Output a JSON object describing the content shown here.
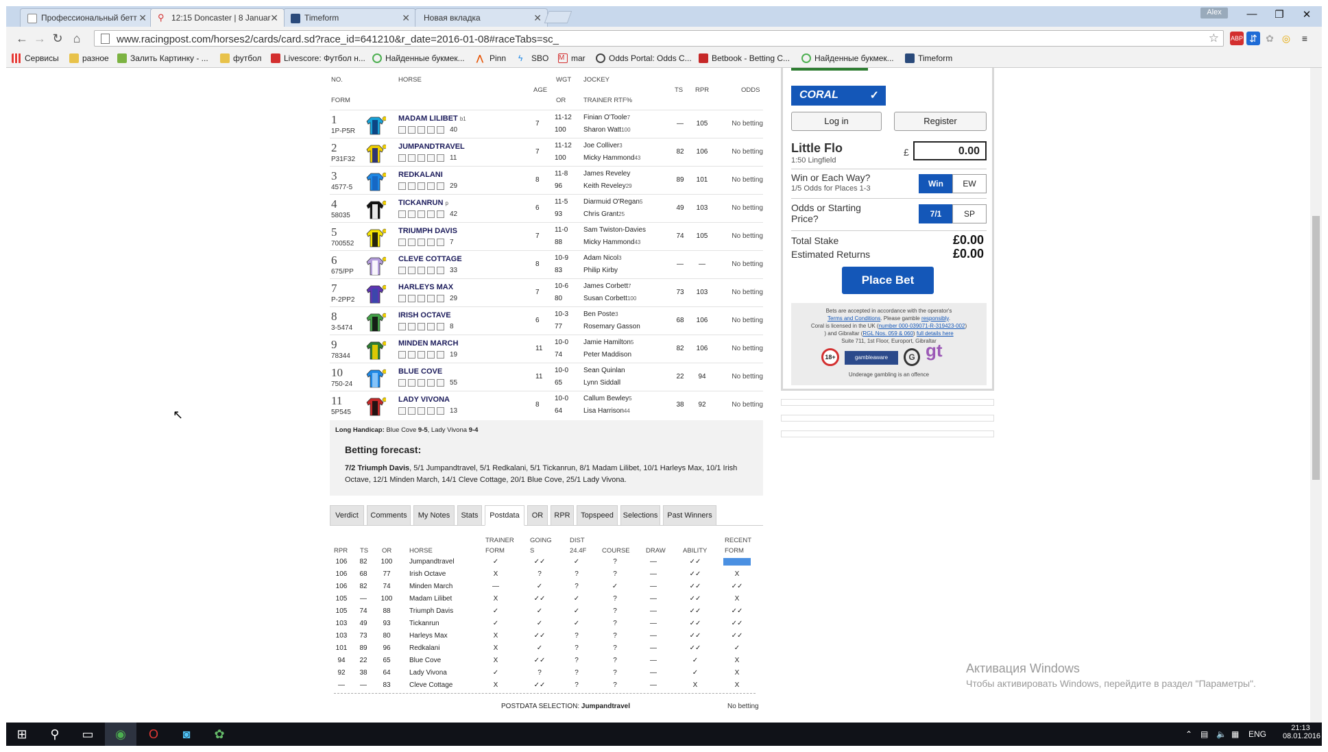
{
  "tabs": [
    {
      "title": "Профессиональный бетт",
      "active": false
    },
    {
      "title": "12:15 Doncaster | 8 Januar",
      "active": true
    },
    {
      "title": "Timeform",
      "active": false
    },
    {
      "title": "Новая вкладка",
      "active": false
    }
  ],
  "window": {
    "user": "Alex",
    "minimize": "—",
    "restore": "❐",
    "close": "✕"
  },
  "toolbar": {
    "url": "www.racingpost.com/horses2/cards/card.sd?race_id=641210&r_date=2016-01-08#raceTabs=sc_"
  },
  "bookmarks": [
    "Сервисы",
    "разное",
    "Залить Картинку - ...",
    "футбол",
    "Livescore: Футбол н...",
    "Найденные букмек...",
    "Pinn",
    "SBO",
    "mar",
    "Odds Portal: Odds C...",
    "Betbook - Betting C...",
    "Найденные букмек...",
    "Timeform"
  ],
  "card_headers": {
    "no": "NO.",
    "horse": "HORSE",
    "form": "FORM",
    "age": "AGE",
    "wgt": "WGT",
    "or": "OR",
    "jockey": "JOCKEY",
    "trainer": "TRAINER RTF%",
    "ts": "TS",
    "rpr": "RPR",
    "odds": "ODDS"
  },
  "runners": [
    {
      "no": "1",
      "form": "1P-P5R",
      "name": "MADAM LILIBET",
      "gear": "b1",
      "days": "40",
      "age": "7",
      "wgt": "11-12",
      "or": "100",
      "jockey": "Finian O'Toole",
      "jclaim": "7",
      "trainer": "Sharon Watt",
      "tpct": "100",
      "ts": "—",
      "rpr": "105",
      "odds": "No betting",
      "colors": [
        "#19a3d8",
        "#0b3b7a"
      ]
    },
    {
      "no": "2",
      "form": "P31F32",
      "name": "JUMPANDTRAVEL",
      "gear": "",
      "days": "11",
      "age": "7",
      "wgt": "11-12",
      "or": "100",
      "jockey": "Joe Colliver",
      "jclaim": "3",
      "trainer": "Micky Hammond",
      "tpct": "43",
      "ts": "82",
      "rpr": "106",
      "odds": "No betting",
      "colors": [
        "#f0d000",
        "#1a237e"
      ]
    },
    {
      "no": "3",
      "form": "4577-5",
      "name": "REDKALANI",
      "gear": "",
      "days": "29",
      "age": "8",
      "wgt": "11-8",
      "or": "96",
      "jockey": "James Reveley",
      "jclaim": "",
      "trainer": "Keith Reveley",
      "tpct": "29",
      "ts": "89",
      "rpr": "101",
      "odds": "No betting",
      "colors": [
        "#1e88e5",
        "#1565c0"
      ]
    },
    {
      "no": "4",
      "form": "58035",
      "name": "TICKANRUN",
      "gear": "p",
      "days": "42",
      "age": "6",
      "wgt": "11-5",
      "or": "93",
      "jockey": "Diarmuid O'Regan",
      "jclaim": "5",
      "trainer": "Chris Grant",
      "tpct": "25",
      "ts": "49",
      "rpr": "103",
      "odds": "No betting",
      "colors": [
        "#111111",
        "#ffffff"
      ]
    },
    {
      "no": "5",
      "form": "700552",
      "name": "TRIUMPH DAVIS",
      "gear": "",
      "days": "7",
      "age": "7",
      "wgt": "11-0",
      "or": "88",
      "jockey": "Sam Twiston-Davies",
      "jclaim": "",
      "trainer": "Micky Hammond",
      "tpct": "43",
      "ts": "74",
      "rpr": "105",
      "odds": "No betting",
      "colors": [
        "#f5e400",
        "#111111"
      ]
    },
    {
      "no": "6",
      "form": "675/PP",
      "name": "CLEVE COTTAGE",
      "gear": "",
      "days": "33",
      "age": "8",
      "wgt": "10-9",
      "or": "83",
      "jockey": "Adam Nicol",
      "jclaim": "3",
      "trainer": "Philip Kirby",
      "tpct": "",
      "ts": "—",
      "rpr": "—",
      "odds": "No betting",
      "colors": [
        "#b39ddb",
        "#ffffff"
      ]
    },
    {
      "no": "7",
      "form": "P-2PP2",
      "name": "HARLEYS MAX",
      "gear": "",
      "days": "29",
      "age": "7",
      "wgt": "10-6",
      "or": "80",
      "jockey": "James Corbett",
      "jclaim": "7",
      "trainer": "Susan Corbett",
      "tpct": "100",
      "ts": "73",
      "rpr": "103",
      "odds": "No betting",
      "colors": [
        "#5e35b1",
        "#3949ab"
      ]
    },
    {
      "no": "8",
      "form": "3-5474",
      "name": "IRISH OCTAVE",
      "gear": "",
      "days": "8",
      "age": "6",
      "wgt": "10-3",
      "or": "77",
      "jockey": "Ben Poste",
      "jclaim": "3",
      "trainer": "Rosemary Gasson",
      "tpct": "",
      "ts": "68",
      "rpr": "106",
      "odds": "No betting",
      "colors": [
        "#43a047",
        "#111111"
      ]
    },
    {
      "no": "9",
      "form": "78344",
      "name": "MINDEN MARCH",
      "gear": "",
      "days": "19",
      "age": "11",
      "wgt": "10-0",
      "or": "74",
      "jockey": "Jamie Hamilton",
      "jclaim": "5",
      "trainer": "Peter Maddison",
      "tpct": "",
      "ts": "82",
      "rpr": "106",
      "odds": "No betting",
      "colors": [
        "#2e7d32",
        "#f0d000"
      ]
    },
    {
      "no": "10",
      "form": "750-24",
      "name": "BLUE COVE",
      "gear": "",
      "days": "55",
      "age": "11",
      "wgt": "10-0",
      "or": "65",
      "jockey": "Sean Quinlan",
      "jclaim": "",
      "trainer": "Lynn Siddall",
      "tpct": "",
      "ts": "22",
      "rpr": "94",
      "odds": "No betting",
      "colors": [
        "#1e88e5",
        "#90caf9"
      ]
    },
    {
      "no": "11",
      "form": "5P545",
      "name": "LADY VIVONA",
      "gear": "",
      "days": "13",
      "age": "8",
      "wgt": "10-0",
      "or": "64",
      "jockey": "Callum Bewley",
      "jclaim": "5",
      "trainer": "Lisa Harrison",
      "tpct": "44",
      "ts": "38",
      "rpr": "92",
      "odds": "No betting",
      "colors": [
        "#c62828",
        "#111111"
      ]
    }
  ],
  "long_handicap": {
    "label": "Long Handicap:",
    "text1": "Blue Cove",
    "w1": "9-5",
    "text2": ", Lady Vivona",
    "w2": "9-4"
  },
  "forecast": {
    "title": "Betting forecast:",
    "lead": "7/2 Triumph Davis",
    "rest": ", 5/1 Jumpandtravel, 5/1 Redkalani, 5/1 Tickanrun, 8/1 Madam Lilibet, 10/1 Harleys Max, 10/1 Irish Octave, 12/1 Minden March, 14/1 Cleve Cottage, 20/1 Blue Cove, 25/1 Lady Vivona."
  },
  "race_tabs": [
    "Verdict",
    "Comments",
    "My Notes",
    "Stats",
    "Postdata",
    "OR",
    "RPR",
    "Topspeed",
    "Selections",
    "Past Winners"
  ],
  "postdata_headers": {
    "rpr": "RPR",
    "ts": "TS",
    "or": "OR",
    "horse": "HORSE",
    "trainer1": "TRAINER",
    "trainer2": "FORM",
    "going1": "GOING",
    "going2": "S",
    "dist1": "DIST",
    "dist2": "24.4F",
    "course": "COURSE",
    "draw": "DRAW",
    "ability": "ABILITY",
    "recent1": "RECENT",
    "recent2": "FORM"
  },
  "postdata": [
    {
      "rpr": "106",
      "ts": "82",
      "or": "100",
      "horse": "Jumpandtravel",
      "trainer": "✓",
      "going": "✓✓",
      "dist": "✓",
      "course": "?",
      "draw": "—",
      "ability": "✓✓",
      "recent": "✓✓"
    },
    {
      "rpr": "106",
      "ts": "68",
      "or": "77",
      "horse": "Irish Octave",
      "trainer": "X",
      "going": "?",
      "dist": "?",
      "course": "?",
      "draw": "—",
      "ability": "✓✓",
      "recent": "X"
    },
    {
      "rpr": "106",
      "ts": "82",
      "or": "74",
      "horse": "Minden March",
      "trainer": "—",
      "going": "✓",
      "dist": "?",
      "course": "✓",
      "draw": "—",
      "ability": "✓✓",
      "recent": "✓✓"
    },
    {
      "rpr": "105",
      "ts": "—",
      "or": "100",
      "horse": "Madam Lilibet",
      "trainer": "X",
      "going": "✓✓",
      "dist": "✓",
      "course": "?",
      "draw": "—",
      "ability": "✓✓",
      "recent": "X"
    },
    {
      "rpr": "105",
      "ts": "74",
      "or": "88",
      "horse": "Triumph Davis",
      "trainer": "✓",
      "going": "✓",
      "dist": "✓",
      "course": "?",
      "draw": "—",
      "ability": "✓✓",
      "recent": "✓✓"
    },
    {
      "rpr": "103",
      "ts": "49",
      "or": "93",
      "horse": "Tickanrun",
      "trainer": "✓",
      "going": "✓",
      "dist": "✓",
      "course": "?",
      "draw": "—",
      "ability": "✓✓",
      "recent": "✓✓"
    },
    {
      "rpr": "103",
      "ts": "73",
      "or": "80",
      "horse": "Harleys Max",
      "trainer": "X",
      "going": "✓✓",
      "dist": "?",
      "course": "?",
      "draw": "—",
      "ability": "✓✓",
      "recent": "✓✓"
    },
    {
      "rpr": "101",
      "ts": "89",
      "or": "96",
      "horse": "Redkalani",
      "trainer": "X",
      "going": "✓",
      "dist": "?",
      "course": "?",
      "draw": "—",
      "ability": "✓✓",
      "recent": "✓"
    },
    {
      "rpr": "94",
      "ts": "22",
      "or": "65",
      "horse": "Blue Cove",
      "trainer": "X",
      "going": "✓✓",
      "dist": "?",
      "course": "?",
      "draw": "—",
      "ability": "✓",
      "recent": "X"
    },
    {
      "rpr": "92",
      "ts": "38",
      "or": "64",
      "horse": "Lady Vivona",
      "trainer": "✓",
      "going": "?",
      "dist": "?",
      "course": "?",
      "draw": "—",
      "ability": "✓",
      "recent": "X"
    },
    {
      "rpr": "—",
      "ts": "—",
      "or": "83",
      "horse": "Cleve Cottage",
      "trainer": "X",
      "going": "✓✓",
      "dist": "?",
      "course": "?",
      "draw": "—",
      "ability": "X",
      "recent": "X"
    }
  ],
  "postdata_selection": {
    "label": "POSTDATA SELECTION:",
    "horse": "Jumpandtravel",
    "odds": "No betting"
  },
  "betslip": {
    "brand": "CORAL",
    "login": "Log in",
    "register": "Register",
    "horse": "Little Flo",
    "race": "1:50 Lingfield",
    "currency": "£",
    "stake": "0.00",
    "q1": "Win or Each Way?",
    "q1sub": "1/5 Odds for Places 1-3",
    "win": "Win",
    "ew": "EW",
    "q2a": "Odds or Starting",
    "q2b": "Price?",
    "price": "7/1",
    "sp": "SP",
    "total_label": "Total Stake",
    "total": "£0.00",
    "returns_label": "Estimated Returns",
    "returns": "£0.00",
    "place": "Place Bet",
    "legal1": "Bets are accepted in accordance with the operator's",
    "legal_terms": "Terms and Conditions",
    "legal2": ". Please gamble",
    "legal_resp": "responsibly",
    "legal3": "Coral is licensed in the UK (",
    "legal_num": "number 000-039071-R-319423-002",
    "legal4": ") and Gibraltar (",
    "legal_rgl": "RGL Nos. 059 & 060",
    "legal5": ")",
    "legal_full": "full details here",
    "legal6": "Suite 711, 1st Floor, Europort, Gibraltar",
    "age": "18+",
    "ga": "gambleaware",
    "gc": "G",
    "gt": "gt",
    "underage": "Underage gambling is an offence",
    "accent": "#1457b8"
  },
  "watermark": {
    "line1": "Активация Windows",
    "line2": "Чтобы активировать Windows, перейдите в раздел \"Параметры\"."
  },
  "taskbar": {
    "lang": "ENG",
    "time": "21:13",
    "date": "08.01.2016"
  }
}
